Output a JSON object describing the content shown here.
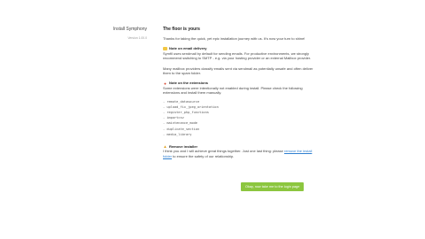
{
  "sidebar": {
    "title": "Install Symphony",
    "version": "Version 1.00.0"
  },
  "main": {
    "heading": "The floor is yours",
    "intro": "Thanks for taking the quick, yet epic installation journey with us. It's now your turn to shine!",
    "email": {
      "title": "Note on email delivery",
      "p1": "Symfil uses sendmail by default for sending emails. For productive environments, we strongly recommend switching to SMTP - e.g. via your hosting provider or an external Mailbox provider.",
      "p2": "Many mailbox providers classify emails sent via sendmail as potentially unsafe and often deliver them to the spam folder."
    },
    "extensions": {
      "title": "Note on the extensions",
      "text": "Some extensions were intentionally not enabled during install. Please check the following extensions and install them manually.",
      "items": [
        "remote_datasource",
        "upload_fix_jpeg_orientation",
        "register_php_functions",
        "importcsv",
        "maintenance_mode",
        "duplicate_section",
        "media_library"
      ]
    },
    "remove": {
      "title": "Remove installer",
      "text_before": "I think you and I will achieve great things together. Just one last thing: please",
      "link": "remove the install folder",
      "text_after": "to ensure the safety of our relationship."
    }
  },
  "actions": {
    "primary_label": "Okay, now take me to the login page"
  },
  "colors": {
    "button_bg": "#8cc63f",
    "link": "#2f7fd0"
  }
}
